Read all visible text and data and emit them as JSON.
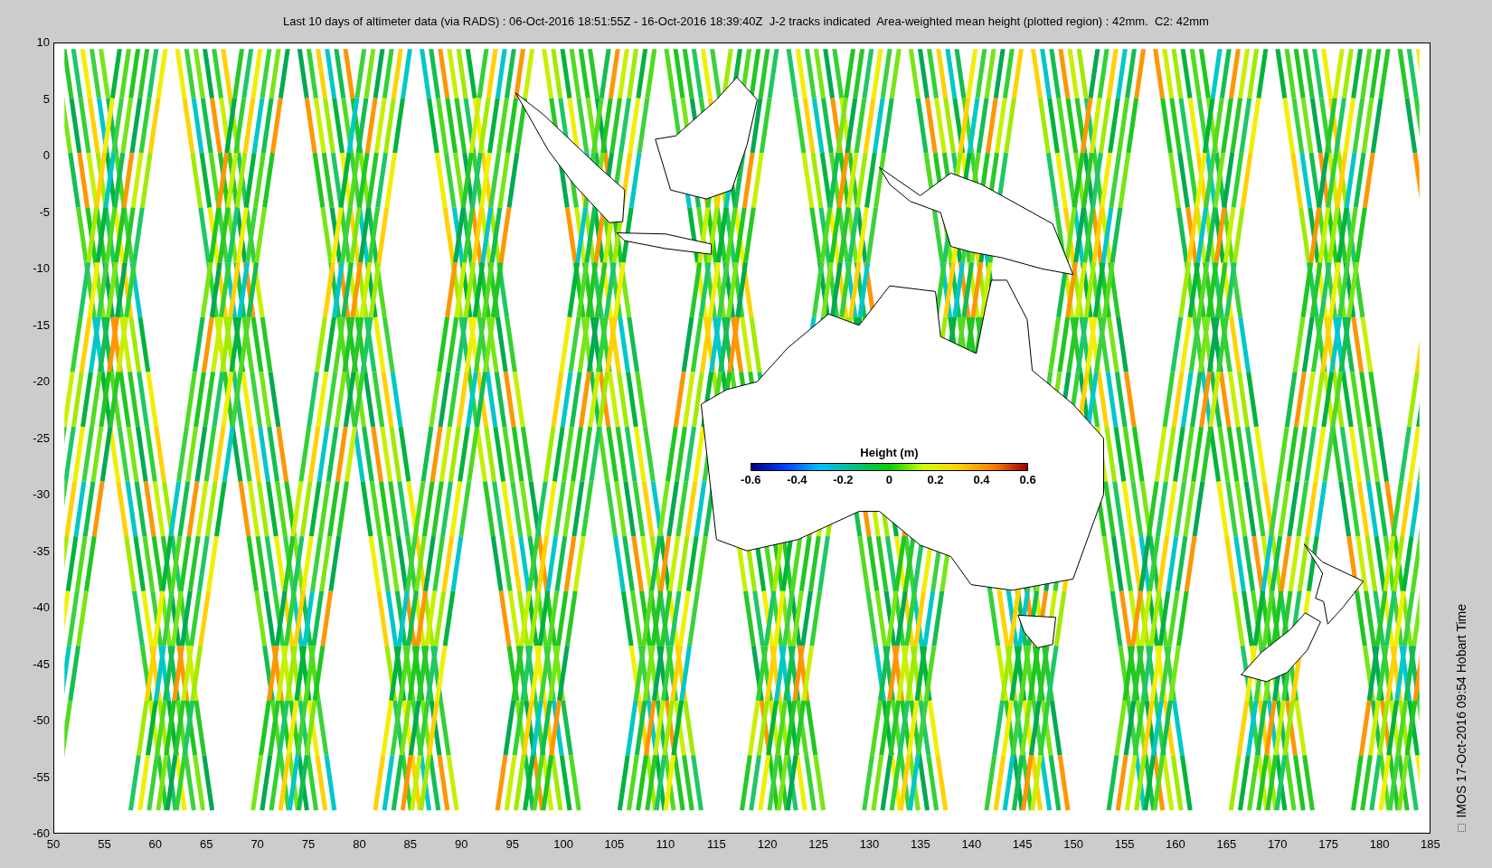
{
  "title": "Last 10 days of altimeter data (via RADS) : 06-Oct-2016 18:51:55Z - 16-Oct-2016 18:39:40Z  J-2 tracks indicated  Area-weighted mean height (plotted region) : 42mm.  C2: 42mm",
  "y_ticks": [
    "10",
    "5",
    "0",
    "-5",
    "-10",
    "-15",
    "-20",
    "-25",
    "-30",
    "-35",
    "-40",
    "-45",
    "-50",
    "-55",
    "-60"
  ],
  "x_ticks": [
    "50",
    "55",
    "60",
    "65",
    "70",
    "75",
    "80",
    "85",
    "90",
    "95",
    "100",
    "105",
    "110",
    "115",
    "120",
    "125",
    "130",
    "135",
    "140",
    "145",
    "150",
    "155",
    "160",
    "165",
    "170",
    "175",
    "180",
    "185"
  ],
  "colorbar": {
    "title": "Height (m)",
    "ticks": [
      "-0.6",
      "-0.4",
      "-0.2",
      "0",
      "0.2",
      "0.4",
      "0.6"
    ]
  },
  "side_text": "IMOS 17-Oct-2016 09:54 Hobart Time"
}
